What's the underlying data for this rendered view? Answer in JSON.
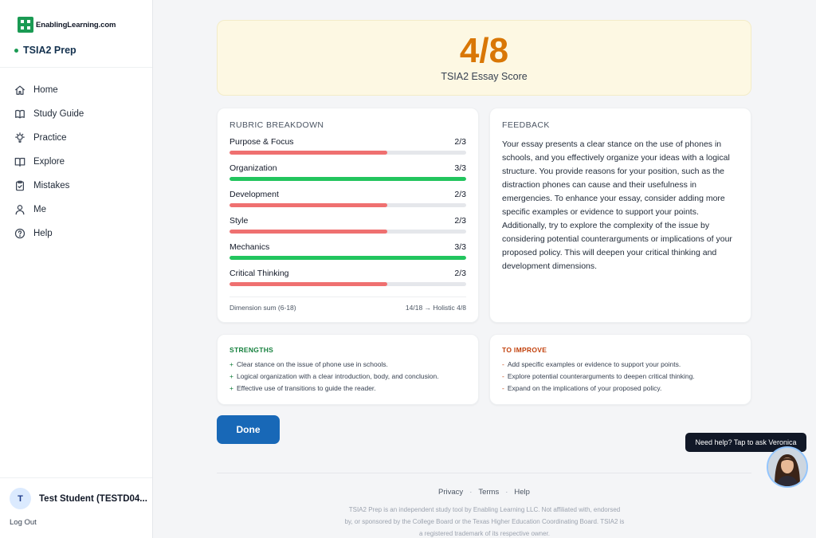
{
  "brand": {
    "logo_text": "EnablingLearning.com",
    "product": "TSIA2 Prep"
  },
  "nav": [
    {
      "label": "Home",
      "icon": "home-icon"
    },
    {
      "label": "Study Guide",
      "icon": "book-icon"
    },
    {
      "label": "Practice",
      "icon": "lightbulb-icon"
    },
    {
      "label": "Explore",
      "icon": "book-open-icon"
    },
    {
      "label": "Mistakes",
      "icon": "clipboard-icon"
    },
    {
      "label": "Me",
      "icon": "user-icon"
    },
    {
      "label": "Help",
      "icon": "help-circle-icon"
    }
  ],
  "user": {
    "initial": "T",
    "name": "Test Student (TESTD04...",
    "logout": "Log Out"
  },
  "score": {
    "value": "4/8",
    "label": "TSIA2 Essay Score"
  },
  "rubric": {
    "title": "RUBRIC BREAKDOWN",
    "rows": [
      {
        "name": "Purpose & Focus",
        "score": "2/3",
        "fraction": 0.667,
        "color": "#ef7070"
      },
      {
        "name": "Organization",
        "score": "3/3",
        "fraction": 1.0,
        "color": "#22c55e"
      },
      {
        "name": "Development",
        "score": "2/3",
        "fraction": 0.667,
        "color": "#ef7070"
      },
      {
        "name": "Style",
        "score": "2/3",
        "fraction": 0.667,
        "color": "#ef7070"
      },
      {
        "name": "Mechanics",
        "score": "3/3",
        "fraction": 1.0,
        "color": "#22c55e"
      },
      {
        "name": "Critical Thinking",
        "score": "2/3",
        "fraction": 0.667,
        "color": "#ef7070"
      }
    ],
    "footer_left": "Dimension sum (6-18)",
    "footer_right": "14/18 → Holistic 4/8"
  },
  "feedback": {
    "title": "FEEDBACK",
    "text": "Your essay presents a clear stance on the use of phones in schools, and you effectively organize your ideas with a logical structure. You provide reasons for your position, such as the distraction phones can cause and their usefulness in emergencies. To enhance your essay, consider adding more specific examples or evidence to support your points. Additionally, try to explore the complexity of the issue by considering potential counterarguments or implications of your proposed policy. This will deepen your critical thinking and development dimensions."
  },
  "strengths": {
    "title": "STRENGTHS",
    "color": "#15803d",
    "bullet": "+",
    "items": [
      "Clear stance on the issue of phone use in schools.",
      "Logical organization with a clear introduction, body, and conclusion.",
      "Effective use of transitions to guide the reader."
    ]
  },
  "improve": {
    "title": "TO IMPROVE",
    "color": "#c2410c",
    "bullet": "-",
    "items": [
      "Add specific examples or evidence to support your points.",
      "Explore potential counterarguments to deepen critical thinking.",
      "Expand on the implications of your proposed policy."
    ]
  },
  "done_label": "Done",
  "assistant": {
    "prompt": "Need help? Tap to ask Veronica"
  },
  "footer": {
    "links": [
      "Privacy",
      "Terms",
      "Help"
    ],
    "disclaimer": "TSIA2 Prep is an independent study tool by Enabling Learning LLC. Not affiliated with, endorsed by, or sponsored by the College Board or the Texas Higher Education Coordinating Board. TSIA2 is a registered trademark of its respective owner."
  }
}
